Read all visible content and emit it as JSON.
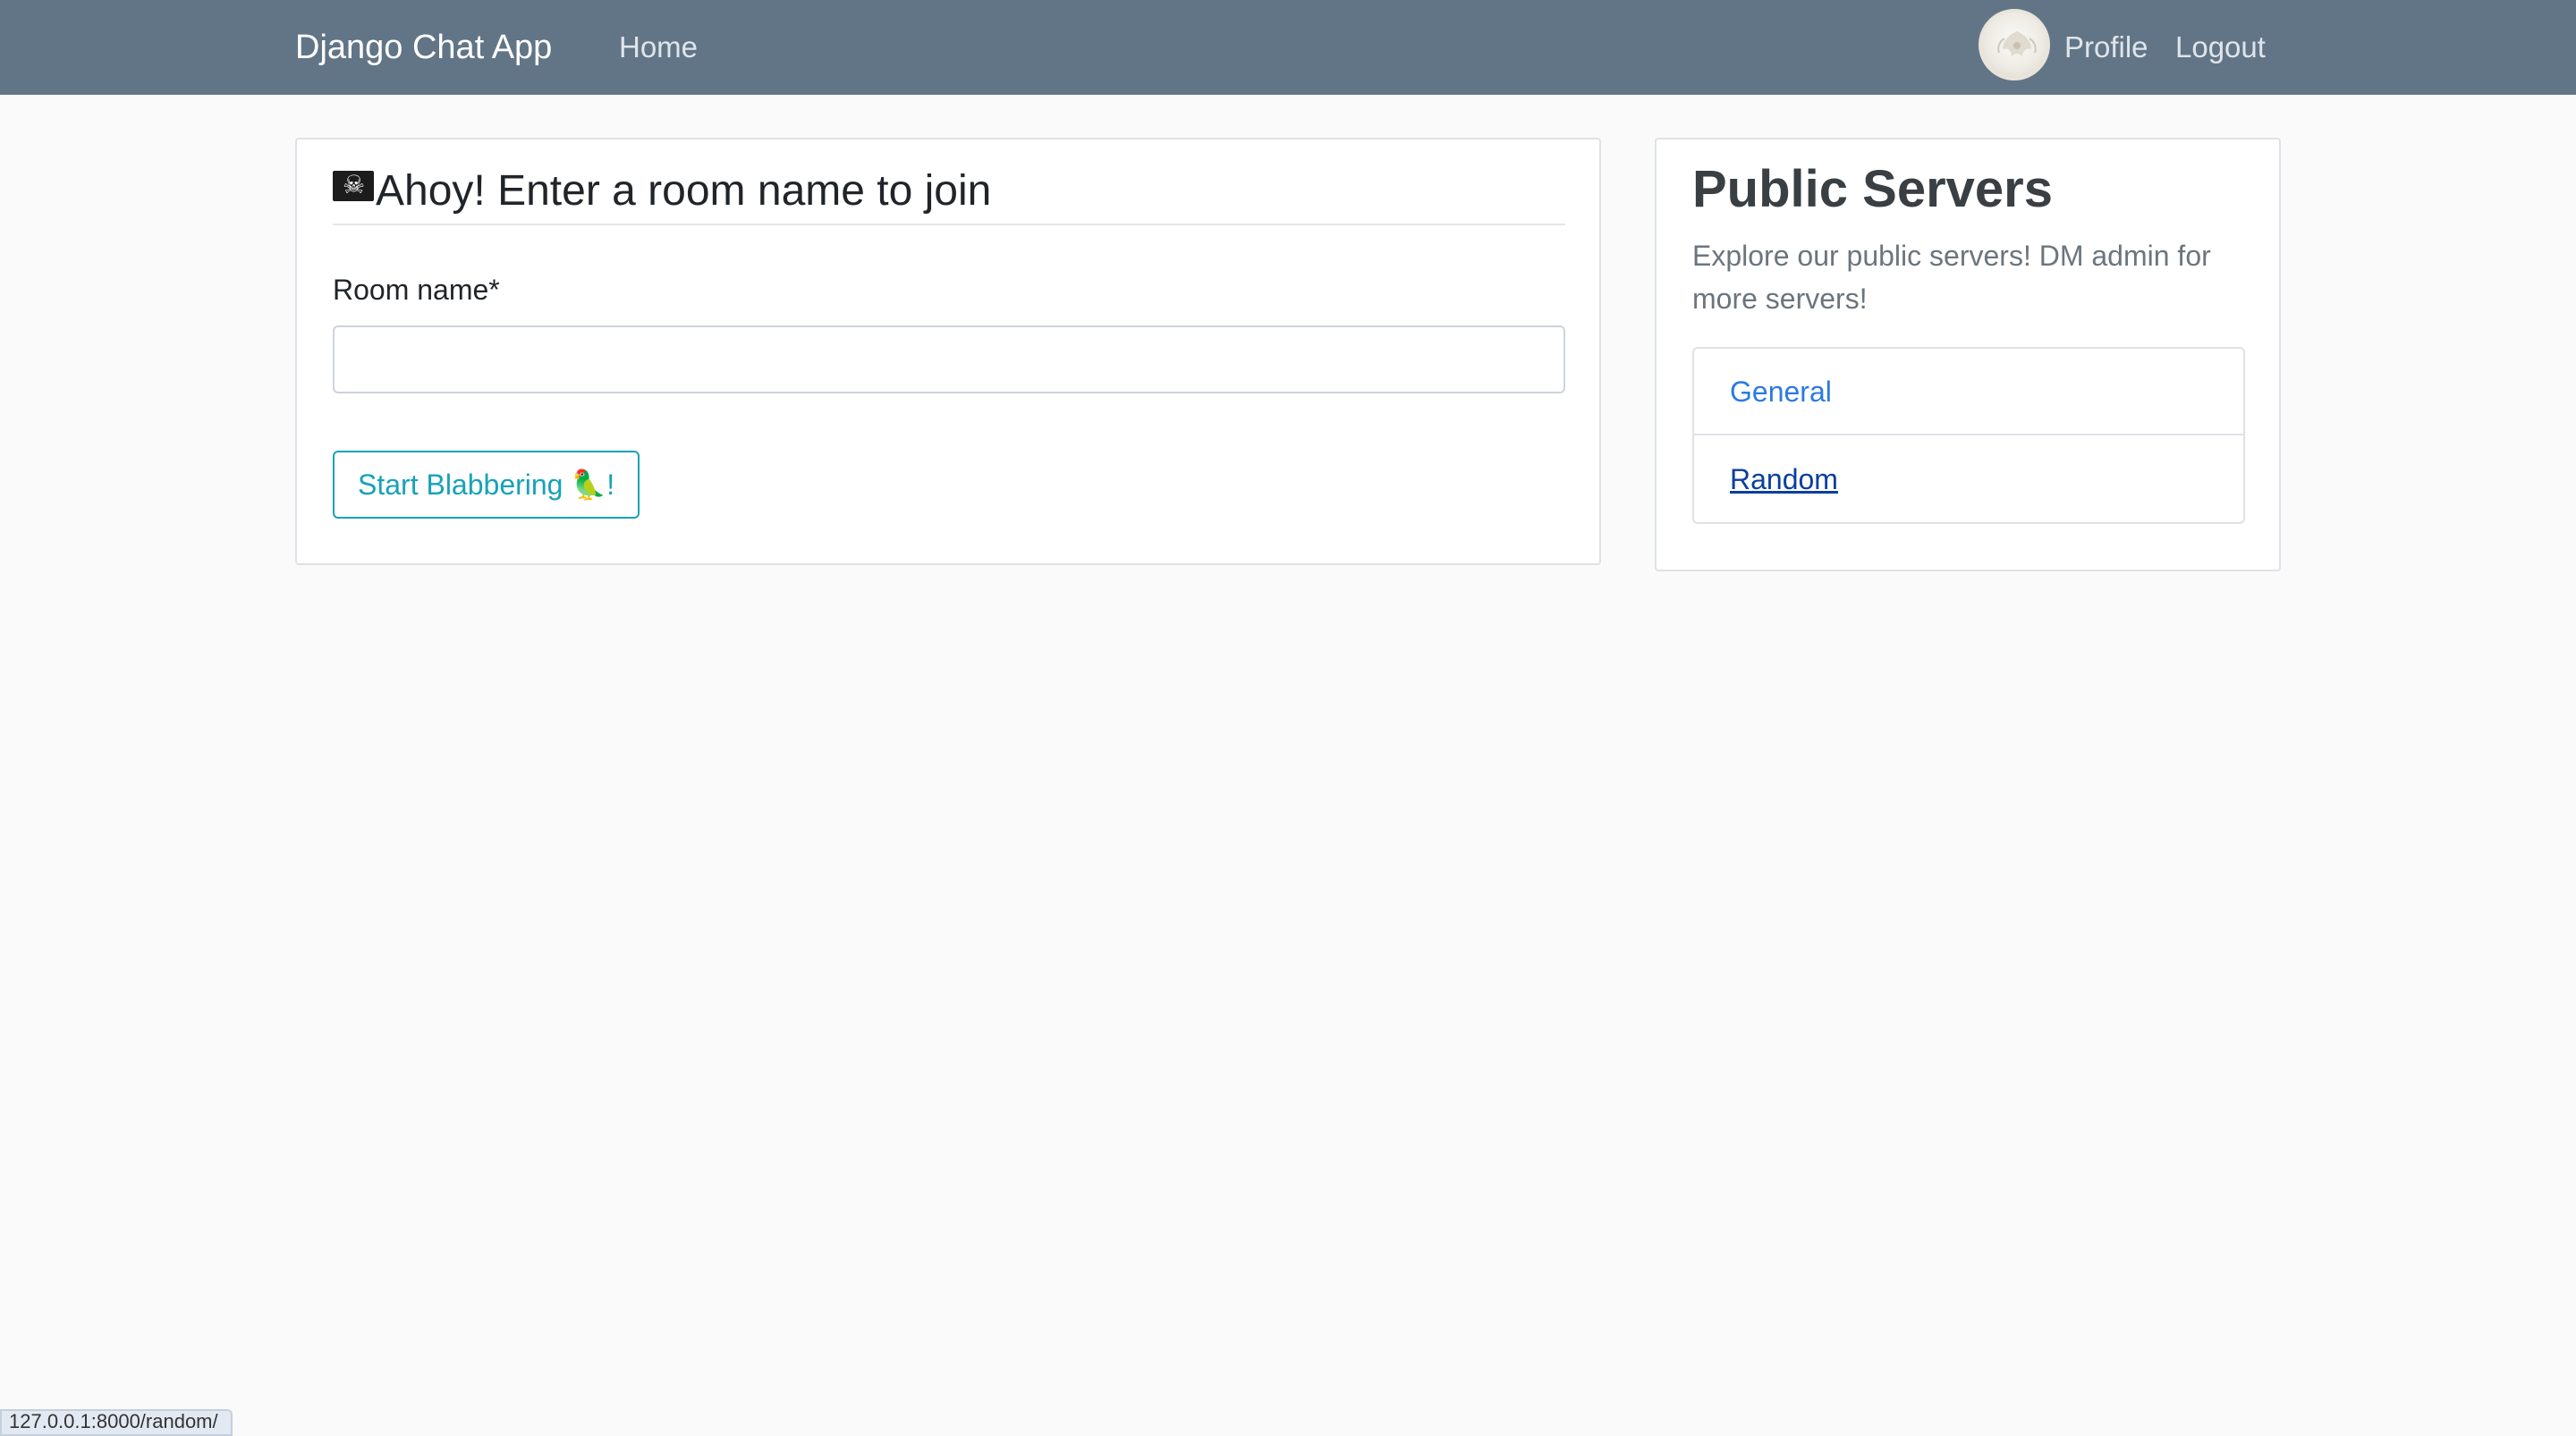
{
  "navbar": {
    "brand": "Django Chat App",
    "home_label": "Home",
    "profile_label": "Profile",
    "logout_label": "Logout",
    "background": "#627587"
  },
  "join_card": {
    "title": "Ahoy! Enter a room name to join",
    "title_icon": "pirate-flag-icon",
    "room_label": "Room name*",
    "room_value": "",
    "button_label": "Start Blabbering 🦜!",
    "accent": "#17a2b8"
  },
  "servers_card": {
    "title": "Public Servers",
    "description": "Explore our public servers! DM admin for more servers!",
    "servers": [
      {
        "label": "General"
      },
      {
        "label": "Random"
      }
    ],
    "link_color": "#2a7ae2"
  },
  "status_bar": {
    "url": "127.0.0.1:8000/random/"
  }
}
